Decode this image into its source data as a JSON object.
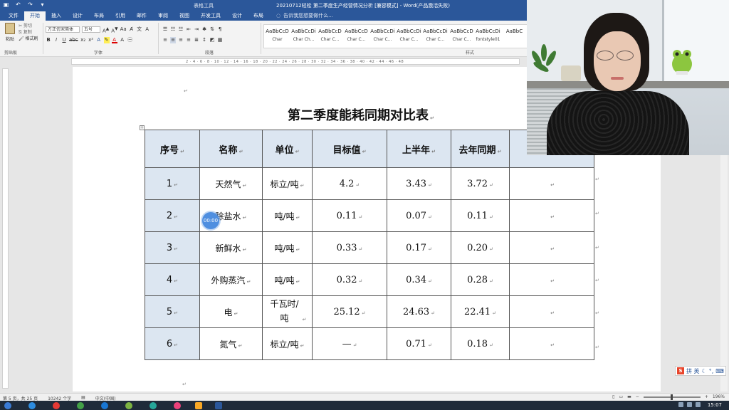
{
  "window": {
    "title": "20210712轻松 第二季度生产经营情况分析 [兼容模式] - Word(产品激活失败)",
    "context_tab_group": "表格工具"
  },
  "tabs": [
    {
      "label": "文件"
    },
    {
      "label": "开始"
    },
    {
      "label": "插入"
    },
    {
      "label": "设计"
    },
    {
      "label": "布局"
    },
    {
      "label": "引用"
    },
    {
      "label": "邮件"
    },
    {
      "label": "审阅"
    },
    {
      "label": "视图"
    },
    {
      "label": "开发工具"
    },
    {
      "label": "设计"
    },
    {
      "label": "布局"
    }
  ],
  "tell_me": "告诉我您想要做什么...",
  "ribbon": {
    "clipboard": {
      "paste": "粘贴",
      "cut": "剪切",
      "copy": "复制",
      "format_painter": "格式刷",
      "label": "剪贴板"
    },
    "font": {
      "name": "方正仿宋简体",
      "size": "五号",
      "label": "字体"
    },
    "paragraph": {
      "label": "段落"
    },
    "styles": {
      "label": "样式",
      "items": [
        {
          "preview": "AaBbCcD",
          "name": "Char"
        },
        {
          "preview": "AaBbCcDi",
          "name": "Char Ch..."
        },
        {
          "preview": "AaBbCcD",
          "name": "Char C..."
        },
        {
          "preview": "AaBbCcD",
          "name": "Char C..."
        },
        {
          "preview": "AaBbCcDi",
          "name": "Char C..."
        },
        {
          "preview": "AaBbCcDi",
          "name": "Char C..."
        },
        {
          "preview": "AaBbCcDi",
          "name": "Char C..."
        },
        {
          "preview": "AaBbCcD",
          "name": "Char C..."
        },
        {
          "preview": "AaBbCcDi",
          "name": "fontstyle01"
        },
        {
          "preview": "AaBbC",
          "name": ""
        }
      ]
    }
  },
  "ruler_ticks": "2 · 4 · 6 · 8 · 10 · 12 · 14 · 16 · 18 · 20 · 22 · 24 · 26 · 28 · 30 · 32 · 34 · 36 · 38 · 40 · 42 · 44 · 46 · 48",
  "document": {
    "heading": "第二季度能耗同期对比表",
    "table": {
      "headers": [
        "序号",
        "名称",
        "单位",
        "目标值",
        "上半年",
        "去年同期",
        ""
      ],
      "rows": [
        [
          "1",
          "天然气",
          "标立/吨",
          "4.2",
          "3.43",
          "3.72",
          ""
        ],
        [
          "2",
          "除盐水",
          "吨/吨",
          "0.11",
          "0.07",
          "0.11",
          ""
        ],
        [
          "3",
          "新鲜水",
          "吨/吨",
          "0.33",
          "0.17",
          "0.20",
          ""
        ],
        [
          "4",
          "外购蒸汽",
          "吨/吨",
          "0.32",
          "0.34",
          "0.28",
          ""
        ],
        [
          "5",
          "电",
          "千瓦时/吨",
          "25.12",
          "24.63",
          "22.41",
          ""
        ],
        [
          "6",
          "氮气",
          "标立/吨",
          "—",
          "0.71",
          "0.18",
          ""
        ]
      ]
    },
    "timer_badge": "00:00"
  },
  "statusbar": {
    "page": "第 5 页，共 25 页",
    "words": "10242 个字",
    "language": "中文(中国)",
    "zoom": "196%"
  },
  "ime": {
    "logo": "S",
    "label": "拼 英"
  },
  "taskbar": {
    "time": "15:07"
  },
  "colors": {
    "word_blue": "#2b579a",
    "table_header_fill": "#dce6f1"
  }
}
